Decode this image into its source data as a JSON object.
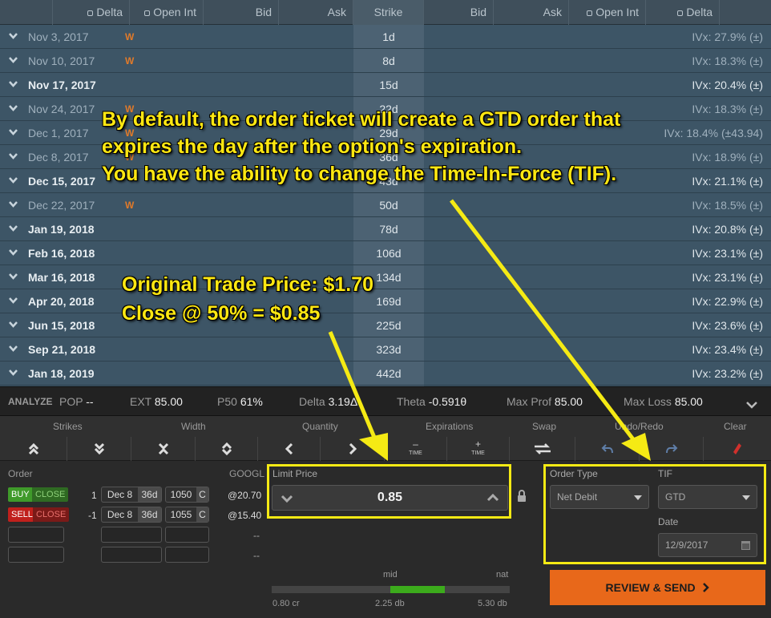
{
  "header": {
    "cols": [
      "Delta",
      "Open Int",
      "Bid",
      "Ask",
      "Strike",
      "Bid",
      "Ask",
      "Open Int",
      "Delta"
    ]
  },
  "expirations": [
    {
      "date": "Nov 3, 2017",
      "weekly": "W",
      "dte": "1d",
      "ivx": "IVx: 27.9% (±)",
      "bold": false
    },
    {
      "date": "Nov 10, 2017",
      "weekly": "W",
      "dte": "8d",
      "ivx": "IVx: 18.3% (±)",
      "bold": false
    },
    {
      "date": "Nov 17, 2017",
      "weekly": "",
      "dte": "15d",
      "ivx": "IVx: 20.4% (±)",
      "bold": true
    },
    {
      "date": "Nov 24, 2017",
      "weekly": "W",
      "dte": "22d",
      "ivx": "IVx: 18.3% (±)",
      "bold": false
    },
    {
      "date": "Dec 1, 2017",
      "weekly": "W",
      "dte": "29d",
      "ivx": "IVx: 18.4% (±43.94)",
      "bold": false
    },
    {
      "date": "Dec 8, 2017",
      "weekly": "W",
      "dte": "36d",
      "ivx": "IVx: 18.9% (±)",
      "bold": false
    },
    {
      "date": "Dec 15, 2017",
      "weekly": "",
      "dte": "43d",
      "ivx": "IVx: 21.1% (±)",
      "bold": true
    },
    {
      "date": "Dec 22, 2017",
      "weekly": "W",
      "dte": "50d",
      "ivx": "IVx: 18.5% (±)",
      "bold": false
    },
    {
      "date": "Jan 19, 2018",
      "weekly": "",
      "dte": "78d",
      "ivx": "IVx: 20.8% (±)",
      "bold": true
    },
    {
      "date": "Feb 16, 2018",
      "weekly": "",
      "dte": "106d",
      "ivx": "IVx: 23.1% (±)",
      "bold": true
    },
    {
      "date": "Mar 16, 2018",
      "weekly": "",
      "dte": "134d",
      "ivx": "IVx: 23.1% (±)",
      "bold": true
    },
    {
      "date": "Apr 20, 2018",
      "weekly": "",
      "dte": "169d",
      "ivx": "IVx: 22.9% (±)",
      "bold": true
    },
    {
      "date": "Jun 15, 2018",
      "weekly": "",
      "dte": "225d",
      "ivx": "IVx: 23.6% (±)",
      "bold": true
    },
    {
      "date": "Sep 21, 2018",
      "weekly": "",
      "dte": "323d",
      "ivx": "IVx: 23.4% (±)",
      "bold": true
    },
    {
      "date": "Jan 18, 2019",
      "weekly": "",
      "dte": "442d",
      "ivx": "IVx: 23.2% (±)",
      "bold": true
    }
  ],
  "analyze": {
    "label": "ANALYZE",
    "pop_label": "POP",
    "pop": "--",
    "ext_label": "EXT",
    "ext": "85.00",
    "p50_label": "P50",
    "p50": "61%",
    "delta_label": "Delta",
    "delta": "3.19Δ",
    "theta_label": "Theta",
    "theta": "-0.591θ",
    "maxprof_label": "Max Prof",
    "maxprof": "85.00",
    "maxloss_label": "Max Loss",
    "maxloss": "85.00"
  },
  "toolbar": {
    "strikes": "Strikes",
    "width": "Width",
    "quantity": "Quantity",
    "expirations": "Expirations",
    "swap": "Swap",
    "undo_redo": "Undo/Redo",
    "clear": "Clear",
    "time": "TIME"
  },
  "order": {
    "label": "Order",
    "symbol": "GOOGL",
    "legs": [
      {
        "side": "BUY",
        "action": "CLOSE",
        "qty": "1",
        "exp": "Dec 8",
        "dte": "36d",
        "strike": "1050",
        "type": "C",
        "price": "@20.70"
      },
      {
        "side": "SELL",
        "action": "CLOSE",
        "qty": "-1",
        "exp": "Dec 8",
        "dte": "36d",
        "strike": "1055",
        "type": "C",
        "price": "@15.40"
      }
    ],
    "empty_price": "--"
  },
  "limit": {
    "label": "Limit Price",
    "value": "0.85"
  },
  "order_type": {
    "label": "Order Type",
    "value": "Net Debit",
    "tif_label": "TIF",
    "tif_value": "GTD",
    "date_label": "Date",
    "date_value": "12/9/2017"
  },
  "price_slider": {
    "mid_label": "mid",
    "nat_label": "nat",
    "left": "0.80 cr",
    "center": "2.25 db",
    "right": "5.30 db"
  },
  "review_button": "REVIEW & SEND",
  "annotations": {
    "tif_note_1": "By default, the order ticket will create a GTD order that",
    "tif_note_2": "expires the day after the option's expiration.",
    "tif_note_3": "You have the ability to change the Time-In-Force (TIF).",
    "price_note_1": "Original Trade Price: $1.70",
    "price_note_2": "Close @ 50% = $0.85"
  },
  "colors": {
    "buy": "#3f9a2a",
    "sell": "#c0201c",
    "accent": "#e8681a",
    "highlight": "#f5ea14",
    "weekly": "#e07a2a"
  }
}
